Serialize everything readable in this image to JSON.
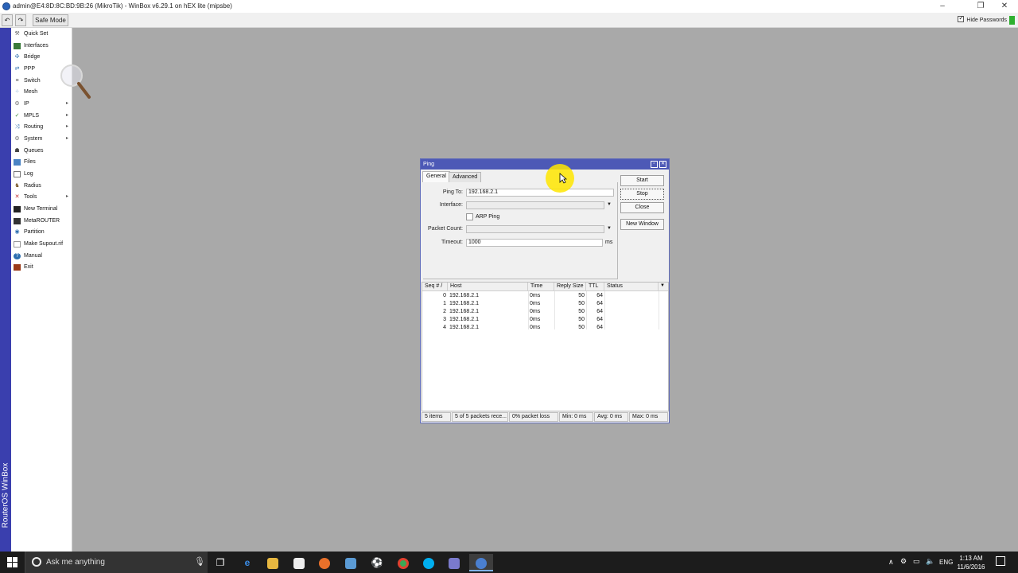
{
  "window": {
    "title": "admin@E4:8D:8C:BD:9B:26 (MikroTik) - WinBox v6.29.1 on hEX lite (mipsbe)",
    "minimize": "–",
    "maximize": "❐",
    "close": "✕"
  },
  "toolbar": {
    "undo": "↶",
    "redo": "↷",
    "safe_mode": "Safe Mode",
    "hide_passwords": "Hide Passwords"
  },
  "side_brand": "RouterOS WinBox",
  "menu": [
    {
      "label": "Quick Set",
      "icon": "quick-set-icon",
      "submenu": false
    },
    {
      "label": "Interfaces",
      "icon": "interfaces-icon",
      "submenu": false
    },
    {
      "label": "Bridge",
      "icon": "bridge-icon",
      "submenu": false
    },
    {
      "label": "PPP",
      "icon": "ppp-icon",
      "submenu": false
    },
    {
      "label": "Switch",
      "icon": "switch-icon",
      "submenu": false
    },
    {
      "label": "Mesh",
      "icon": "mesh-icon",
      "submenu": false
    },
    {
      "label": "IP",
      "icon": "ip-icon",
      "submenu": true
    },
    {
      "label": "MPLS",
      "icon": "mpls-icon",
      "submenu": true
    },
    {
      "label": "Routing",
      "icon": "routing-icon",
      "submenu": true
    },
    {
      "label": "System",
      "icon": "system-icon",
      "submenu": true
    },
    {
      "label": "Queues",
      "icon": "queues-icon",
      "submenu": false
    },
    {
      "label": "Files",
      "icon": "files-icon",
      "submenu": false
    },
    {
      "label": "Log",
      "icon": "log-icon",
      "submenu": false
    },
    {
      "label": "Radius",
      "icon": "radius-icon",
      "submenu": false
    },
    {
      "label": "Tools",
      "icon": "tools-icon",
      "submenu": true
    },
    {
      "label": "New Terminal",
      "icon": "terminal-icon",
      "submenu": false
    },
    {
      "label": "MetaROUTER",
      "icon": "metarouter-icon",
      "submenu": false
    },
    {
      "label": "Partition",
      "icon": "partition-icon",
      "submenu": false
    },
    {
      "label": "Make Supout.rif",
      "icon": "supout-icon",
      "submenu": false
    },
    {
      "label": "Manual",
      "icon": "manual-icon",
      "submenu": false
    },
    {
      "label": "Exit",
      "icon": "exit-icon",
      "submenu": false
    }
  ],
  "ping": {
    "title": "Ping",
    "tabs": {
      "general": "General",
      "advanced": "Advanced"
    },
    "labels": {
      "ping_to": "Ping To:",
      "interface": "Interface:",
      "arp_ping": "ARP Ping",
      "packet_count": "Packet Count:",
      "timeout": "Timeout:",
      "timeout_unit": "ms"
    },
    "values": {
      "ping_to": "192.168.2.1",
      "interface": "",
      "packet_count": "",
      "timeout": "1000"
    },
    "buttons": {
      "start": "Start",
      "stop": "Stop",
      "close": "Close",
      "new_window": "New Window"
    },
    "columns": [
      "Seq # /",
      "Host",
      "Time",
      "Reply Size",
      "TTL",
      "Status"
    ],
    "rows": [
      {
        "seq": "0",
        "host": "192.168.2.1",
        "time": "0ms",
        "size": "50",
        "ttl": "64",
        "status": ""
      },
      {
        "seq": "1",
        "host": "192.168.2.1",
        "time": "0ms",
        "size": "50",
        "ttl": "64",
        "status": ""
      },
      {
        "seq": "2",
        "host": "192.168.2.1",
        "time": "0ms",
        "size": "50",
        "ttl": "64",
        "status": ""
      },
      {
        "seq": "3",
        "host": "192.168.2.1",
        "time": "0ms",
        "size": "50",
        "ttl": "64",
        "status": ""
      },
      {
        "seq": "4",
        "host": "192.168.2.1",
        "time": "0ms",
        "size": "50",
        "ttl": "64",
        "status": ""
      }
    ],
    "status": {
      "items": "5 items",
      "packets": "5 of 5 packets rece...",
      "loss": "0% packet loss",
      "min": "Min: 0 ms",
      "avg": "Avg: 0 ms",
      "max": "Max: 0 ms"
    }
  },
  "taskbar": {
    "search_placeholder": "Ask me anything",
    "language": "ENG",
    "time": "1:13 AM",
    "date": "11/6/2016"
  }
}
